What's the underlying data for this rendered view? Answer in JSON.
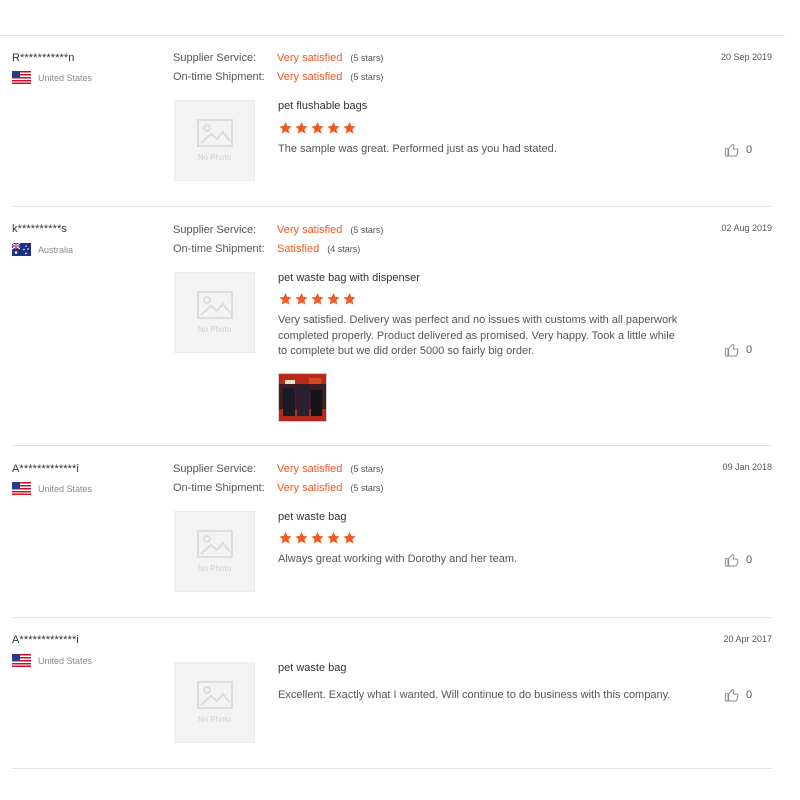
{
  "accent_color": "#f05a24",
  "reviews": [
    {
      "buyer": "R***********n",
      "country": "United States",
      "flag_icon": "us-flag-icon",
      "date": "20 Sep 2019",
      "supplier_service_label": "Supplier Service:",
      "supplier_service_value": "Very satisfied",
      "supplier_service_stars": "(5 stars)",
      "shipment_label": "On-time Shipment:",
      "shipment_value": "Very satisfied",
      "shipment_stars": "(5 stars)",
      "no_photo": "No Photo",
      "product": "pet flushable bags",
      "rating": 5,
      "comment": "The sample was great.  Performed just as you had stated.",
      "likes": "0"
    },
    {
      "buyer": "k**********s",
      "country": "Australia",
      "flag_icon": "au-flag-icon",
      "date": "02 Aug 2019",
      "supplier_service_label": "Supplier Service:",
      "supplier_service_value": "Very satisfied",
      "supplier_service_stars": "(5 stars)",
      "shipment_label": "On-time Shipment:",
      "shipment_value": "Satisfied",
      "shipment_stars": "(4 stars)",
      "no_photo": "No Photo",
      "product": "pet waste bag with dispenser",
      "rating": 5,
      "comment": "Very satisfied. Delivery was perfect and no issues with customs with all paperwork completed properly. Product delivered as promised. Very happy. Took a little while to complete but we did order 5000 so fairly big order.",
      "likes": "0"
    },
    {
      "buyer": "A*************i",
      "country": "United States",
      "flag_icon": "us-flag-icon",
      "date": "09 Jan 2018",
      "supplier_service_label": "Supplier Service:",
      "supplier_service_value": "Very satisfied",
      "supplier_service_stars": "(5 stars)",
      "shipment_label": "On-time Shipment:",
      "shipment_value": "Very satisfied",
      "shipment_stars": "(5 stars)",
      "no_photo": "No Photo",
      "product": "pet waste bag",
      "rating": 5,
      "comment": "Always great working with Dorothy and her team.",
      "likes": "0"
    },
    {
      "buyer": "A*************i",
      "country": "United States",
      "flag_icon": "us-flag-icon",
      "date": "20 Apr 2017",
      "no_photo": "No Photo",
      "product": "pet waste bag",
      "comment": "Excellent. Exactly what I wanted. Will continue to do business with this company.",
      "likes": "0"
    }
  ]
}
